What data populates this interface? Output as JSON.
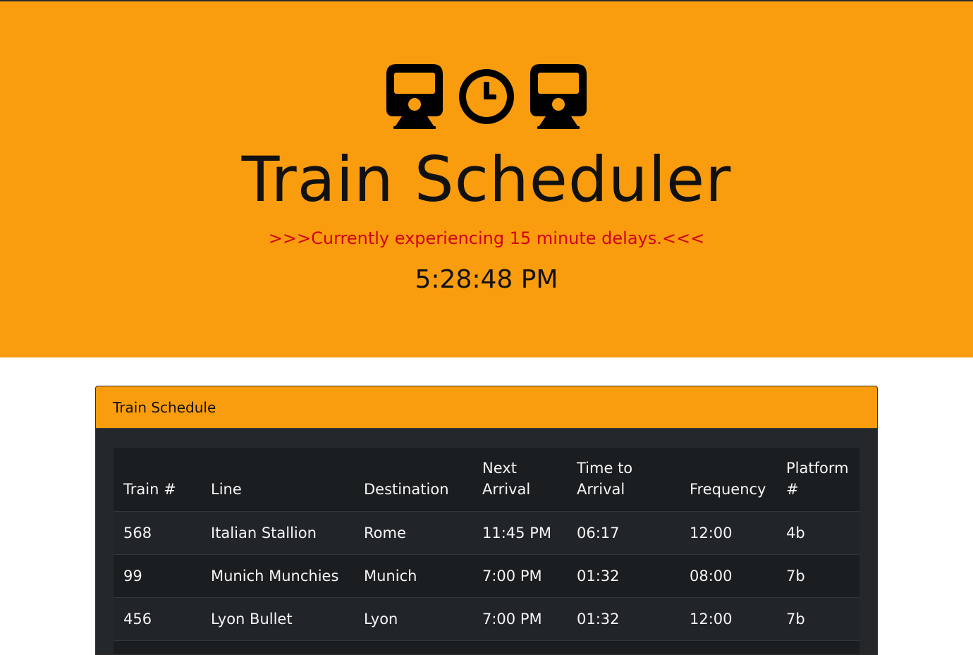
{
  "hero": {
    "icons": [
      "train-icon",
      "clock-icon",
      "train-icon"
    ],
    "title": "Train Scheduler",
    "delay_notice": ">>>Currently experiencing 15 minute delays.<<<",
    "current_time": "5:28:48 PM"
  },
  "colors": {
    "accent": "#f99c0d",
    "notice": "#d0021b",
    "table_dark": "#212529"
  },
  "schedule": {
    "title": "Train Schedule",
    "columns": {
      "train": "Train #",
      "line": "Line",
      "destination": "Destination",
      "next_arrival_1": "Next",
      "next_arrival_2": "Arrival",
      "time_to_1": "Time to",
      "time_to_2": "Arrival",
      "frequency": "Frequency",
      "platform_1": "Platform",
      "platform_2": "#"
    },
    "rows": [
      {
        "train": "568",
        "line": "Italian Stallion",
        "destination": "Rome",
        "next_arrival": "11:45 PM",
        "time_to_arrival": "06:17",
        "frequency": "12:00",
        "platform": "4b"
      },
      {
        "train": "99",
        "line": "Munich Munchies",
        "destination": "Munich",
        "next_arrival": "7:00 PM",
        "time_to_arrival": "01:32",
        "frequency": "08:00",
        "platform": "7b"
      },
      {
        "train": "456",
        "line": "Lyon Bullet",
        "destination": "Lyon",
        "next_arrival": "7:00 PM",
        "time_to_arrival": "01:32",
        "frequency": "12:00",
        "platform": "7b"
      },
      {
        "train": "",
        "line": "",
        "destination": "",
        "next_arrival": "",
        "time_to_arrival": "",
        "frequency": "",
        "platform": ""
      }
    ]
  }
}
